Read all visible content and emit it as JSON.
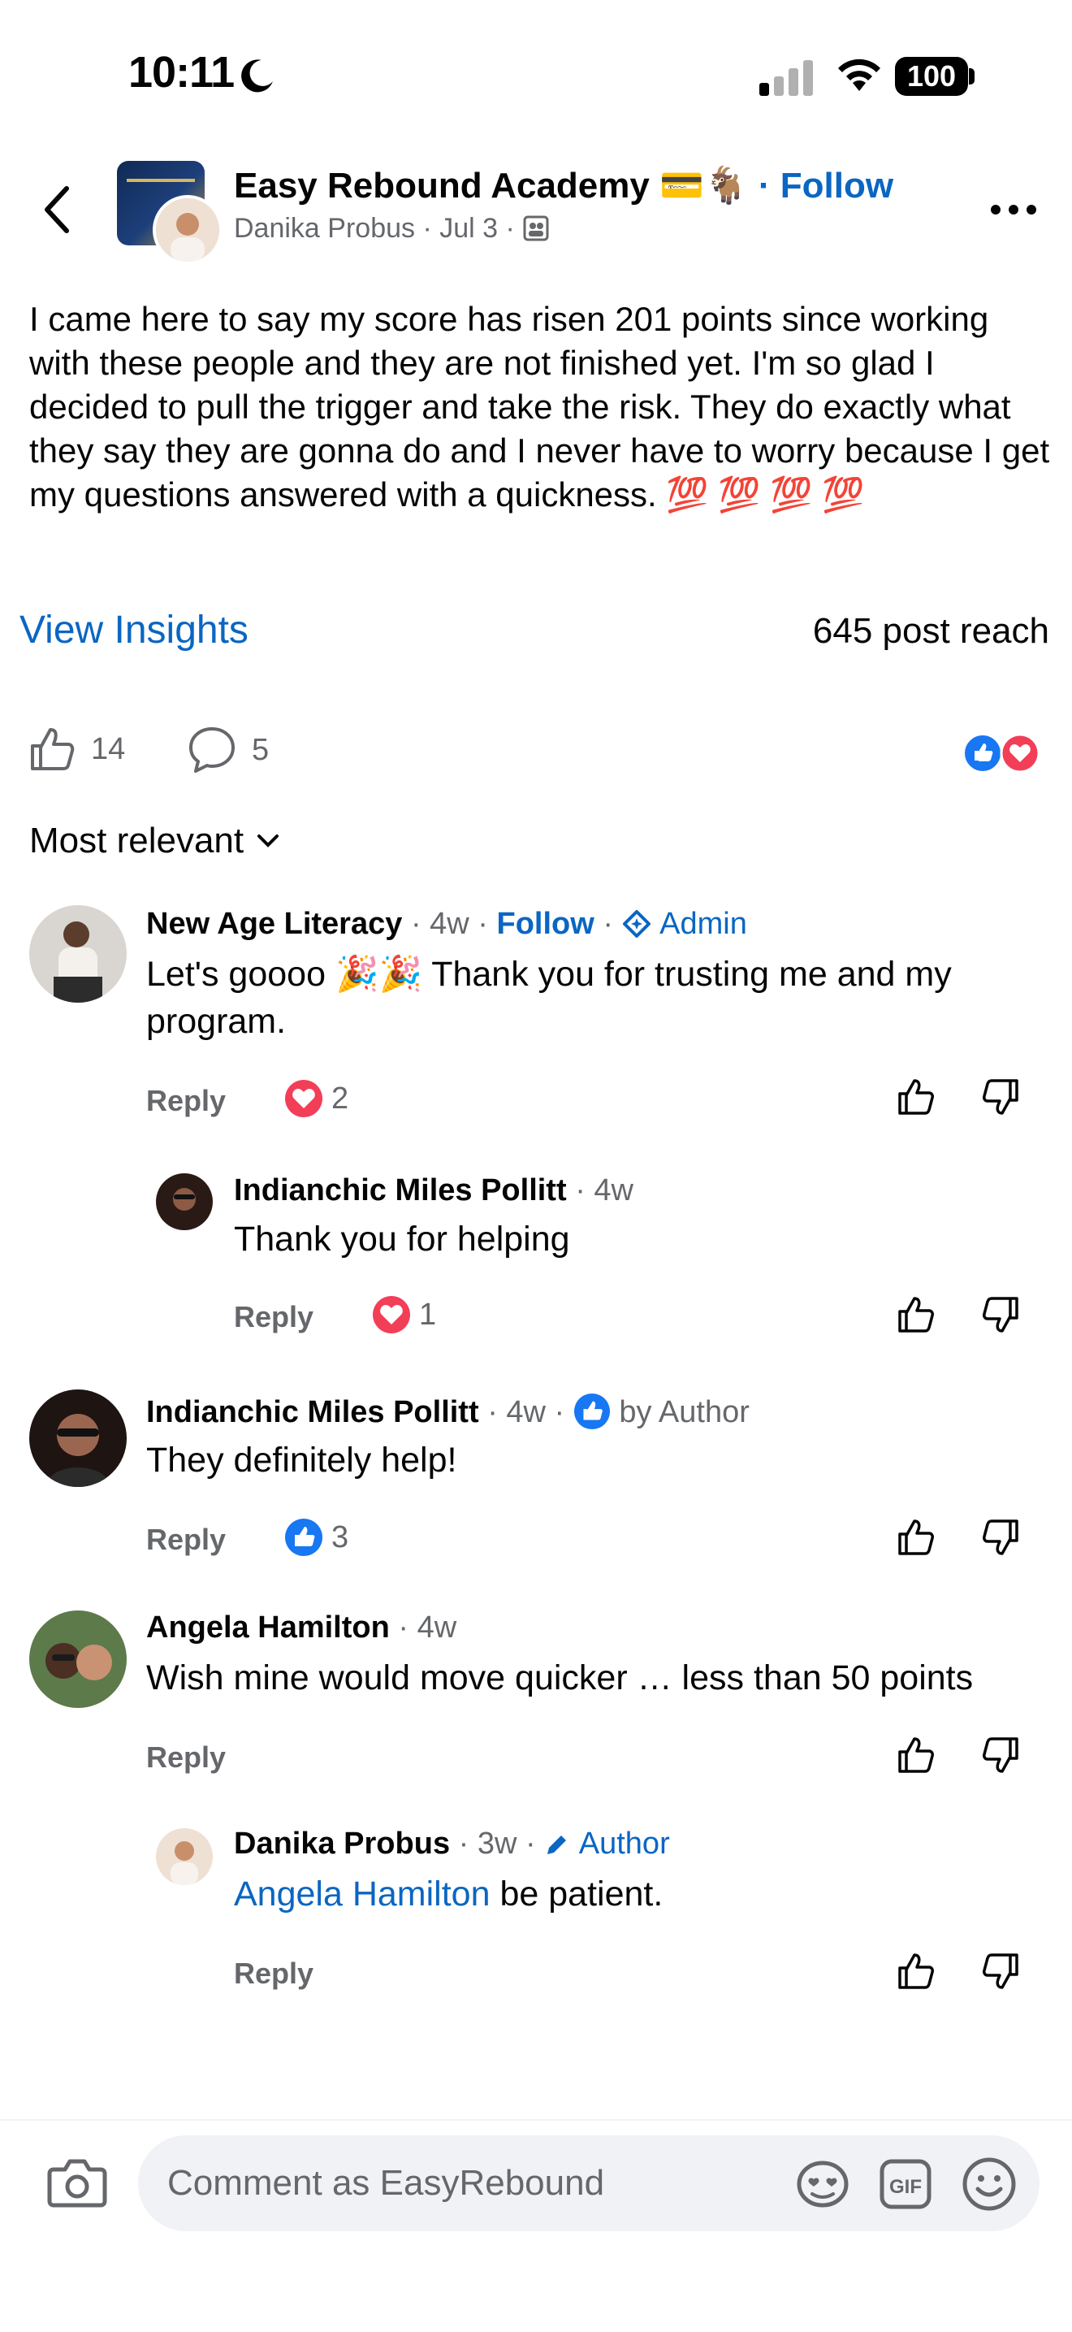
{
  "status_bar": {
    "time": "10:11",
    "battery": "100"
  },
  "header": {
    "group_name": "Easy Rebound Academy 💳🐐",
    "follow_label": "· Follow",
    "author": "Danika Probus",
    "date": "· Jul 3 ·"
  },
  "post": {
    "text": "I came here to say my score has risen 201 points since working with these people and they are not finished yet. I'm so glad I decided to pull the trigger and take the risk.    They do exactly what they say they are gonna do and I never have to worry because I get my questions answered with a quickness. 💯 💯 💯 💯",
    "insights_label": "View Insights",
    "reach": "645 post reach",
    "like_count": "14",
    "comment_count": "5",
    "sort_label": "Most relevant"
  },
  "comments": [
    {
      "name": "New Age Literacy",
      "meta": "· 4w ·",
      "follow": "Follow",
      "badge": "Admin",
      "text": "Let's goooo 🎉🎉 Thank you for trusting me and my program.",
      "reply": "Reply",
      "reactions": "2"
    },
    {
      "name": "Indianchic Miles Pollitt",
      "meta": "· 4w",
      "text": "Thank you for helping",
      "reply": "Reply",
      "reactions": "1"
    },
    {
      "name": "Indianchic Miles Pollitt",
      "meta": "· 4w ·",
      "by": "by Author",
      "text": "They definitely help!",
      "reply": "Reply",
      "reactions": "3"
    },
    {
      "name": "Angela Hamilton",
      "meta": "· 4w",
      "text": "Wish mine would move quicker … less than 50 points",
      "reply": "Reply"
    },
    {
      "name": "Danika Probus",
      "meta": "· 3w ·",
      "badge": "Author",
      "mention": "Angela Hamilton",
      "text": " be patient.",
      "reply": "Reply"
    }
  ],
  "composer": {
    "placeholder": "Comment as EasyRebound"
  }
}
